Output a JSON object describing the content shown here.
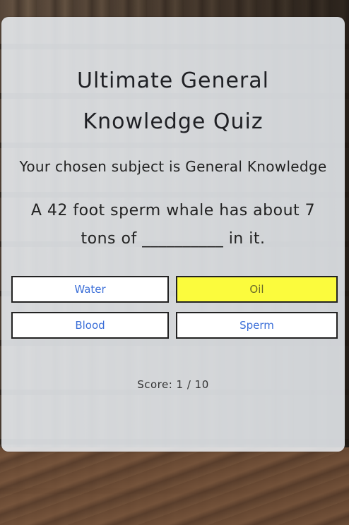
{
  "quiz": {
    "title_line1": "Ultimate General",
    "title_line2": "Knowledge Quiz",
    "subject_text": "Your chosen subject is General Knowledge",
    "question_line1": "A 42 foot sperm whale has about 7",
    "question_line2": "tons of __________ in it.",
    "answers": [
      {
        "label": "Water",
        "selected": false
      },
      {
        "label": "Oil",
        "selected": true
      },
      {
        "label": "Blood",
        "selected": false
      },
      {
        "label": "Sperm",
        "selected": false
      }
    ],
    "score_text": "Score: 1 / 10"
  },
  "colors": {
    "card_background": "#ecf1f6",
    "selected_answer": "#fbfb3d",
    "answer_text": "#3c6fd8",
    "text": "#222222"
  }
}
